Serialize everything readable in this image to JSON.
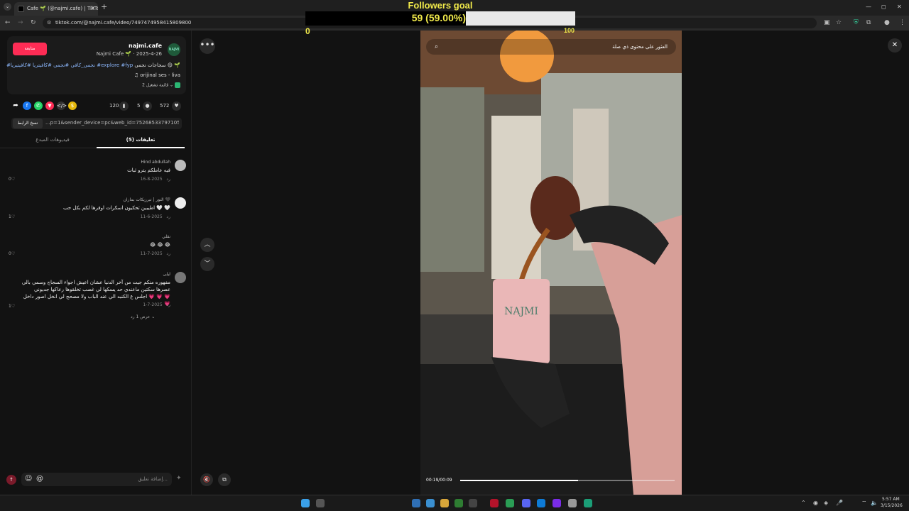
{
  "browser": {
    "tab_title": "Cafe 🌱 (@najmi.cafe) | TikTok",
    "new_tab_label": "+",
    "url": "tiktok.com/@najmi.cafe/video/7497474958415809800",
    "window_controls": [
      "—",
      "◻",
      "✕"
    ]
  },
  "goal_overlay": {
    "title": "Followers goal",
    "value_text": "59 (59.00%)",
    "progress_fraction": 0.59,
    "min": "0",
    "max": "100"
  },
  "post": {
    "follow_label": "متابعة",
    "username": "najmi.cafe",
    "author_meta": "Najmi Cafe 🌱 · 2025-4-26",
    "avatar_text": "NAJMI",
    "caption_text": "سجاجات نجمي 😋 🌱",
    "caption_tags": "#نجمي_كافي #نجمي #كافيتريا #كافيتيريا #explore #fyp",
    "music": "♫ orijinal ses - liva",
    "playlist": "قائمة تشغيل 2 ⌄"
  },
  "stats": {
    "likes": "572",
    "comments": "5",
    "saves": "120"
  },
  "link": {
    "copy_label": "نسخ الرابط",
    "url": "...p=1&sender_device=pc&web_id=7526853379710535176"
  },
  "tabs": {
    "comments": "تعليقات (5)",
    "creator_videos": "فيديوهات المبدع"
  },
  "comments": [
    {
      "user": "Hind abdullah",
      "text": "فيه عاملكم يترو ثبات",
      "date": "2025-8-16",
      "reply": "رد",
      "likes": "0"
    },
    {
      "user": "النور | تبرزيكات بمازان 🖤",
      "text": "اطيبين تحكيون اسكرات اوفرها لكم بكل حب 🤍 🤍",
      "date": "2025-6-11",
      "reply": "رد",
      "likes": "1"
    },
    {
      "user": "نقلي",
      "text": "😂 😂 😂",
      "date": "2025-7-11",
      "reply": "رد",
      "likes": "0"
    },
    {
      "user": "ليلى",
      "text": "مفهوره منكم جيت من آخر الدنيا عشان اعيش اجواء السجاج وسمي بالي عصرها سكتين ماعندي حد يسكها لي غصب تخلقوها رعاكها جديوني اجلس ع الكنبه الي عند الباب ولا مصحح لي انخل اصور داخل 💗 💗 💗 💗",
      "date": "2025-7-1",
      "reply": "رد",
      "likes": "1"
    }
  ],
  "view_replies": "عرض 1 رد ⌄",
  "comment_input": {
    "placeholder": "إضافة تعليق...",
    "emoji": "☺",
    "mention": "@"
  },
  "video": {
    "search_placeholder": "العثور على محتوى ذي صلة",
    "time": "00:19/00:09",
    "progress_fraction": 0.55
  },
  "taskbar": {
    "time": "5:57 AM",
    "date": "3/15/2026"
  },
  "colors": {
    "accent": "#fe2c55",
    "goal_text": "#f0e94a"
  }
}
